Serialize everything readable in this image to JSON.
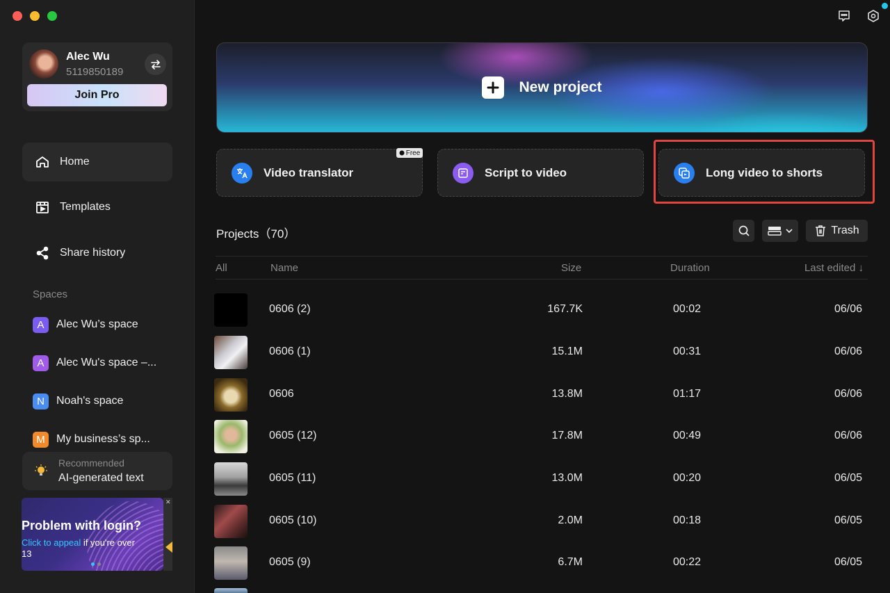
{
  "user": {
    "name": "Alec Wu",
    "id": "5119850189",
    "join_label": "Join Pro"
  },
  "nav": [
    {
      "label": "Home",
      "icon": "home-icon",
      "active": true
    },
    {
      "label": "Templates",
      "icon": "templates-icon",
      "active": false
    },
    {
      "label": "Share history",
      "icon": "share-icon",
      "active": false
    }
  ],
  "spaces": {
    "label": "Spaces",
    "items": [
      {
        "letter": "A",
        "label": "Alec Wu’s space",
        "color": "#7b5cf0"
      },
      {
        "letter": "A",
        "label": "Alec Wu's space –...",
        "color": "#a05ce8"
      },
      {
        "letter": "N",
        "label": "Noah's space",
        "color": "#4a8cf0"
      },
      {
        "letter": "M",
        "label": "My business’s sp...",
        "color": "#f08a2a"
      }
    ]
  },
  "recommended": {
    "small": "Recommended",
    "big": "AI-generated text"
  },
  "banner": {
    "title": "Problem with login?",
    "link": "Click to appeal",
    "rest": " if you're over",
    "line2": "13"
  },
  "new_project": {
    "label": "New project"
  },
  "tools": [
    {
      "label": "Video translator",
      "icon": "translate-icon",
      "color": "#2a7ff0"
    },
    {
      "label": "Script to video",
      "icon": "script-icon",
      "color": "#8a5cf0"
    },
    {
      "label": "Long video to shorts",
      "icon": "shorts-icon",
      "color": "#2a7ff0"
    }
  ],
  "free_badge": "Free",
  "projects": {
    "title": "Projects（70）",
    "trash_label": "Trash",
    "columns": {
      "all": "All",
      "name": "Name",
      "size": "Size",
      "duration": "Duration",
      "last_edited": "Last edited ↓"
    },
    "rows": [
      {
        "name": "0606 (2)",
        "size": "167.7K",
        "duration": "00:02",
        "date": "06/06"
      },
      {
        "name": "0606 (1)",
        "size": "15.1M",
        "duration": "00:31",
        "date": "06/06"
      },
      {
        "name": "0606",
        "size": "13.8M",
        "duration": "01:17",
        "date": "06/06"
      },
      {
        "name": "0605 (12)",
        "size": "17.8M",
        "duration": "00:49",
        "date": "06/06"
      },
      {
        "name": "0605 (11)",
        "size": "13.0M",
        "duration": "00:20",
        "date": "06/05"
      },
      {
        "name": "0605 (10)",
        "size": "2.0M",
        "duration": "00:18",
        "date": "06/05"
      },
      {
        "name": "0605 (9)",
        "size": "6.7M",
        "duration": "00:22",
        "date": "06/05"
      }
    ]
  }
}
